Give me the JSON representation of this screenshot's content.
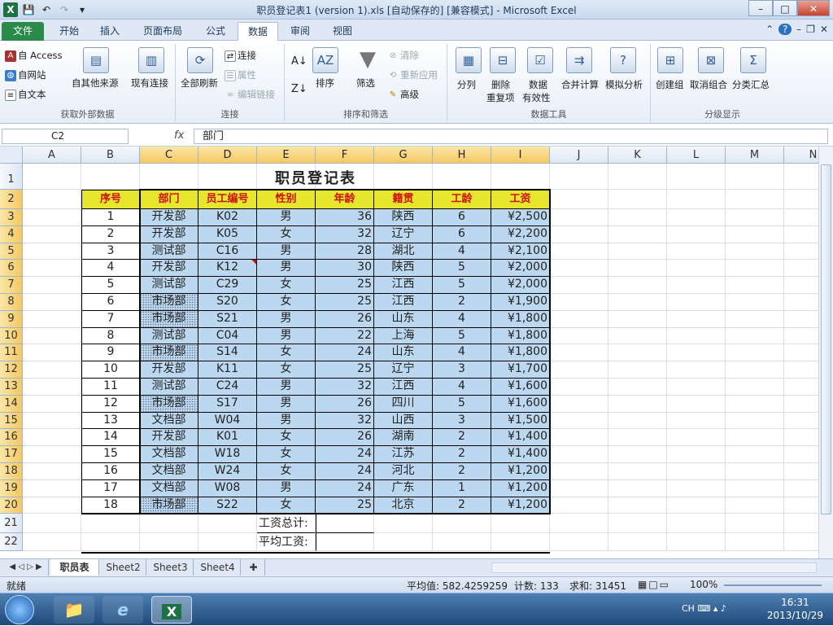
{
  "window": {
    "title": "职员登记表1 (version 1).xls [自动保存的]  [兼容模式]  -  Microsoft Excel",
    "logo": "X",
    "controls": {
      "min": "–",
      "max": "□",
      "close": "✕"
    }
  },
  "ribbon_tabs": [
    "文件",
    "开始",
    "插入",
    "页面布局",
    "公式",
    "数据",
    "审阅",
    "视图"
  ],
  "active_tab": "数据",
  "ribbon": {
    "ext": {
      "label": "获取外部数据",
      "access": "自 Access",
      "web": "自网站",
      "text": "自文本",
      "other": "自其他来源",
      "existing": "现有连接"
    },
    "conn": {
      "label": "连接",
      "refresh": "全部刷新",
      "connections": "连接",
      "props": "属性",
      "edit_links": "编辑链接"
    },
    "sort": {
      "label": "排序和筛选",
      "sort": "排序",
      "filter": "筛选",
      "clear": "清除",
      "reapply": "重新应用",
      "advanced": "高级"
    },
    "tools": {
      "label": "数据工具",
      "split": "分列",
      "dedupe_1": "删除",
      "dedupe_2": "重复项",
      "valid_1": "数据",
      "valid_2": "有效性",
      "consolidate": "合并计算",
      "whatif": "模拟分析"
    },
    "outline": {
      "label": "分级显示",
      "group": "创建组",
      "ungroup": "取消组合",
      "subtotal": "分类汇总"
    }
  },
  "formula_bar": {
    "name_box": "C2",
    "fx": "fx",
    "content": "部门"
  },
  "columns": [
    "A",
    "B",
    "C",
    "D",
    "E",
    "F",
    "G",
    "H",
    "I",
    "J",
    "K",
    "L",
    "M",
    "N"
  ],
  "rows": [
    "1",
    "2",
    "3",
    "4",
    "5",
    "6",
    "7",
    "8",
    "9",
    "10",
    "11",
    "12",
    "13",
    "14",
    "15",
    "16",
    "17",
    "18",
    "19",
    "20",
    "21",
    "22"
  ],
  "sheet": {
    "title": "职员登记表",
    "headers": [
      "序号",
      "部门",
      "员工编号",
      "性别",
      "年龄",
      "籍贯",
      "工龄",
      "工资"
    ],
    "data": [
      [
        "1",
        "开发部",
        "K02",
        "男",
        "36",
        "陕西",
        "6",
        "¥2,500"
      ],
      [
        "2",
        "开发部",
        "K05",
        "女",
        "32",
        "辽宁",
        "6",
        "¥2,200"
      ],
      [
        "3",
        "测试部",
        "C16",
        "男",
        "28",
        "湖北",
        "4",
        "¥2,100"
      ],
      [
        "4",
        "开发部",
        "K12",
        "男",
        "30",
        "陕西",
        "5",
        "¥2,000"
      ],
      [
        "5",
        "测试部",
        "C29",
        "女",
        "25",
        "江西",
        "5",
        "¥2,000"
      ],
      [
        "6",
        "市场部",
        "S20",
        "女",
        "25",
        "江西",
        "2",
        "¥1,900"
      ],
      [
        "7",
        "市场部",
        "S21",
        "男",
        "26",
        "山东",
        "4",
        "¥1,800"
      ],
      [
        "8",
        "测试部",
        "C04",
        "男",
        "22",
        "上海",
        "5",
        "¥1,800"
      ],
      [
        "9",
        "市场部",
        "S14",
        "女",
        "24",
        "山东",
        "4",
        "¥1,800"
      ],
      [
        "10",
        "开发部",
        "K11",
        "女",
        "25",
        "辽宁",
        "3",
        "¥1,700"
      ],
      [
        "11",
        "测试部",
        "C24",
        "男",
        "32",
        "江西",
        "4",
        "¥1,600"
      ],
      [
        "12",
        "市场部",
        "S17",
        "男",
        "26",
        "四川",
        "5",
        "¥1,600"
      ],
      [
        "13",
        "文档部",
        "W04",
        "男",
        "32",
        "山西",
        "3",
        "¥1,500"
      ],
      [
        "14",
        "开发部",
        "K01",
        "女",
        "26",
        "湖南",
        "2",
        "¥1,400"
      ],
      [
        "15",
        "文档部",
        "W18",
        "女",
        "24",
        "江苏",
        "2",
        "¥1,400"
      ],
      [
        "16",
        "文档部",
        "W24",
        "女",
        "24",
        "河北",
        "2",
        "¥1,200"
      ],
      [
        "17",
        "文档部",
        "W08",
        "男",
        "24",
        "广东",
        "1",
        "¥1,200"
      ],
      [
        "18",
        "市场部",
        "S22",
        "女",
        "25",
        "北京",
        "2",
        "¥1,200"
      ]
    ],
    "total_label": "工资总计:",
    "avg_label": "平均工资:"
  },
  "sheet_tabs": [
    "职员表",
    "Sheet2",
    "Sheet3",
    "Sheet4"
  ],
  "status": {
    "mode": "就绪",
    "average": "平均值: 582.4259259",
    "count": "计数: 133",
    "sum": "求和: 31451",
    "zoom": "100%"
  },
  "taskbar": {
    "time": "16:31",
    "date": "2013/10/29",
    "lang": "CH"
  }
}
